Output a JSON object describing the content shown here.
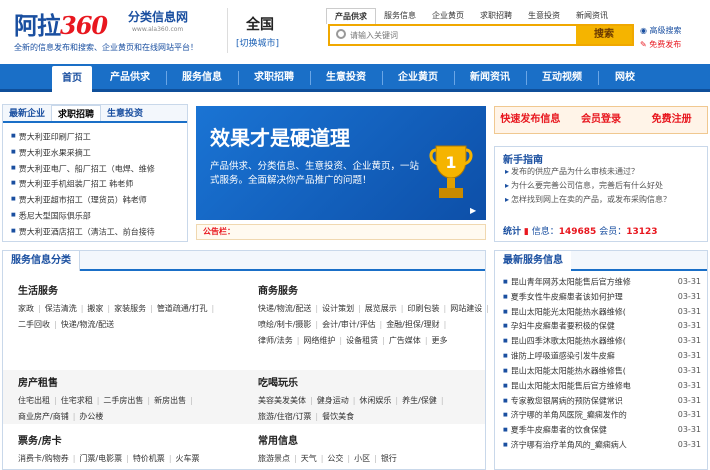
{
  "header": {
    "logo_text": "阿拉",
    "logo_num": "360",
    "logo_sub": "分类信息网",
    "logo_url": "www.ala360.com",
    "slogan": "全新的信息发布和搜索、企业黄页和在线网站平台！",
    "city": "全国",
    "city_switch": "[切换城市]",
    "search_tabs": [
      "产品供求",
      "服务信息",
      "企业黄页",
      "求职招聘",
      "生意投资",
      "新闻资讯"
    ],
    "search_placeholder": "请输入关键词",
    "search_button": "搜索",
    "links": [
      "高级搜索",
      "免费发布"
    ]
  },
  "nav": [
    "首页",
    "产品供求",
    "服务信息",
    "求职招聘",
    "生意投资",
    "企业黄页",
    "新闻资讯",
    "互动视频",
    "网校"
  ],
  "left_box": {
    "tabs": [
      "最新企业",
      "求职招聘",
      "生意投资"
    ],
    "items": [
      "贾大利亚印刷厂招工",
      "贾大利亚水果采摘工",
      "贾大利亚电厂、船厂招工（电焊、维修",
      "贾大利亚手机组装厂招工 韩老师",
      "贾大利亚超市招工（理货员）韩老师",
      "悉尼大型国际俱乐部",
      "贾大利亚酒店招工（清洁工、前台接待"
    ]
  },
  "banner": {
    "title": "效果才是硬道理",
    "desc": "产品供求、分类信息、生意投资、企业黄页，一站式服务。全面解决你产品推广的问题！",
    "trophy_num": "1",
    "note": "▶"
  },
  "notice": "公告栏：",
  "right_buttons": [
    "快速发布信息",
    "会员登录",
    "免费注册"
  ],
  "guide": {
    "title": "新手指南",
    "items": [
      "发布的供应产品为什么审核未通过？",
      "为什么要完善公司信息，完善后有什么好处",
      "怎样找到网上在卖的产品，或发布采购信息？"
    ],
    "stats_label": "统计",
    "info_label": "信息：",
    "info_count": "149685",
    "member_label": "会员：",
    "member_count": "13123"
  },
  "services": {
    "title": "服务信息分类",
    "cats": [
      {
        "name": "生活服务",
        "links": [
          "家政",
          "保洁清洗",
          "搬家",
          "家装服务",
          "管道疏通/打孔",
          "二手回收",
          "快递/物流/配送"
        ]
      },
      {
        "name": "商务服务",
        "links": [
          "快递/物流/配送",
          "设计策划",
          "展览展示",
          "印刷包装",
          "网站建设",
          "喷绘/制卡/摄影",
          "会计/审计/评估",
          "金融/担保/理财",
          "律师/法务",
          "网络维护",
          "设备租赁",
          "广告媒体",
          "更多"
        ]
      },
      {
        "name": "房产租售",
        "links": [
          "住宅出租",
          "住宅求租",
          "二手房出售",
          "新房出售",
          "商业房产/商铺",
          "办公楼"
        ]
      },
      {
        "name": "吃喝玩乐",
        "links": [
          "美容美发美体",
          "健身运动",
          "休闲娱乐",
          "养生/保健",
          "旅游/住宿/订票",
          "餐饮美食"
        ]
      },
      {
        "name": "票务/房卡",
        "links": [
          "消费卡/购物券",
          "门票/电影票",
          "特价机票",
          "火车票"
        ]
      },
      {
        "name": "常用信息",
        "links": [
          "旅游景点",
          "天气",
          "公交",
          "小区",
          "银行"
        ]
      }
    ]
  },
  "news": {
    "title": "最新服务信息",
    "items": [
      {
        "t": "昆山青年网苏太阳能售后官方维修",
        "d": "03-31"
      },
      {
        "t": "夏季女性牛皮癣患者该如何护理",
        "d": "03-31"
      },
      {
        "t": "昆山太阳能光太阳能热水器维修(",
        "d": "03-31"
      },
      {
        "t": "孕妇牛皮癣患者要积极的保健",
        "d": "03-31"
      },
      {
        "t": "昆山四季沐歌太阳能热水器维修(",
        "d": "03-31"
      },
      {
        "t": "谁防上呼吸道感染引发牛皮癣",
        "d": "03-31"
      },
      {
        "t": "昆山太阳能太阳能热水器维修售(",
        "d": "03-31"
      },
      {
        "t": "昆山太阳能太阳能售后官方维修电",
        "d": "03-31"
      },
      {
        "t": "专家教您银屑病的预防保健常识",
        "d": "03-31"
      },
      {
        "t": "济宁哪的羊角风医院_癫痫发作的",
        "d": "03-31"
      },
      {
        "t": "夏季牛皮癣患者的饮食保健",
        "d": "03-31"
      },
      {
        "t": "济宁哪有治疗羊角风的_癫痫病人",
        "d": "03-31"
      }
    ]
  }
}
